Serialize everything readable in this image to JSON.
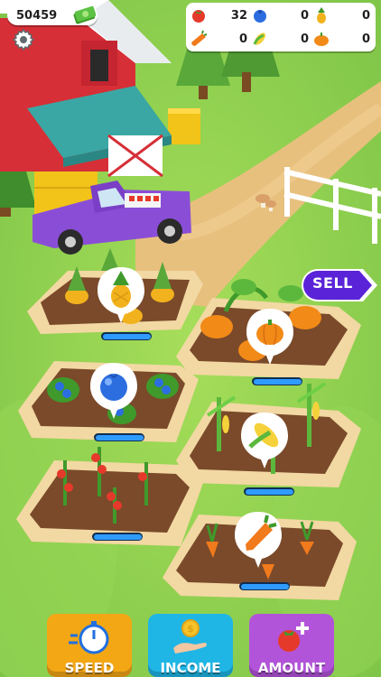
{
  "hud": {
    "money": "50459",
    "money_icon": "cash-stack-icon",
    "settings_icon": "gear-icon"
  },
  "inventory": [
    {
      "crop": "tomato",
      "count": "32",
      "color": "#e53a2b"
    },
    {
      "crop": "blueberry",
      "count": "0",
      "color": "#2c6ee0"
    },
    {
      "crop": "pineapple",
      "count": "0",
      "color": "#f2b21d"
    },
    {
      "crop": "carrot",
      "count": "0",
      "color": "#f07a1c"
    },
    {
      "crop": "corn",
      "count": "0",
      "color": "#8fcf3a"
    },
    {
      "crop": "pumpkin",
      "count": "0",
      "color": "#f28a18"
    }
  ],
  "sell_button": {
    "label": "SELL",
    "color": "#5a23d8"
  },
  "plots": [
    {
      "crop": "pineapple",
      "progress": 1.0
    },
    {
      "crop": "pumpkin",
      "progress": 1.0
    },
    {
      "crop": "blueberry",
      "progress": 1.0
    },
    {
      "crop": "corn",
      "progress": 1.0
    },
    {
      "crop": "tomato",
      "progress": 1.0
    },
    {
      "crop": "carrot",
      "progress": 1.0
    }
  ],
  "upgrades": [
    {
      "label": "SPEED",
      "icon": "stopwatch-icon",
      "color": "#f3a715"
    },
    {
      "label": "INCOME",
      "icon": "coin-hand-icon",
      "color": "#1fb6e6"
    },
    {
      "label": "AMOUNT",
      "icon": "tomato-plus-icon",
      "color": "#b254d9"
    }
  ]
}
